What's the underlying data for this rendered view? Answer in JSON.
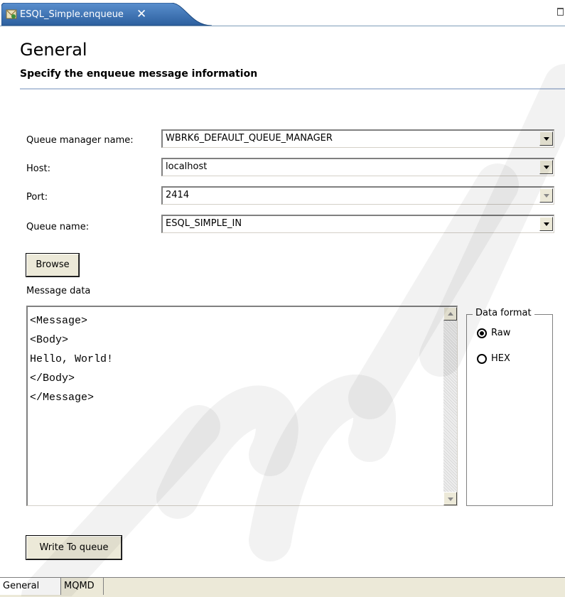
{
  "editor_tab": {
    "title": "ESQL_Simple.enqueue",
    "close_glyph": "✕",
    "icon": "enqueue-file-icon"
  },
  "header": {
    "title": "General",
    "subtitle": "Specify the enqueue message information"
  },
  "form": {
    "queue_manager": {
      "label": "Queue manager name:",
      "value": "WBRK6_DEFAULT_QUEUE_MANAGER"
    },
    "host": {
      "label": "Host:",
      "value": "localhost"
    },
    "port": {
      "label": "Port:",
      "value": "2414",
      "enabled": false
    },
    "queue_name": {
      "label": "Queue name:",
      "value": "ESQL_SIMPLE_IN"
    }
  },
  "browse_button": "Browse",
  "message_data": {
    "label": "Message data",
    "content": "<Message>\n<Body>\nHello, World!\n</Body>\n</Message>"
  },
  "data_format": {
    "title": "Data format",
    "options": [
      {
        "label": "Raw",
        "checked": true
      },
      {
        "label": "HEX",
        "checked": false
      }
    ]
  },
  "write_button": "Write To queue",
  "bottom_tabs": [
    {
      "label": "General",
      "active": true
    },
    {
      "label": "MQMD",
      "active": false
    }
  ],
  "colors": {
    "tab_active": "#3a6ea5",
    "header_rule": "#b7c6dc",
    "button_face": "#ece9d8"
  }
}
